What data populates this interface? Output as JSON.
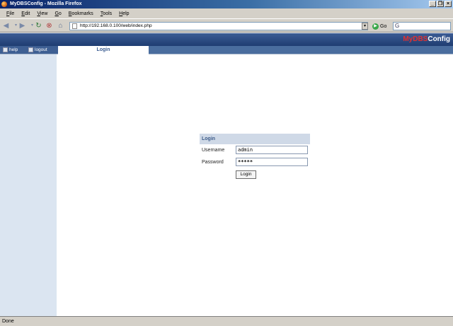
{
  "window": {
    "title": "MyDBSConfig - Mozilla Firefox",
    "controls": [
      "_",
      "❐",
      "×"
    ]
  },
  "menu": [
    "File",
    "Edit",
    "View",
    "Go",
    "Bookmarks",
    "Tools",
    "Help"
  ],
  "toolbar": {
    "url": "http://192.168.0.100/web/index.php",
    "go_label": "Go",
    "search_icon_text": "G"
  },
  "app": {
    "brand_part1": "MyDBS",
    "brand_part2": "Config",
    "nav": {
      "help": "help",
      "logout": "logout"
    },
    "active_tab": "Login"
  },
  "login": {
    "heading": "Login",
    "username_label": "Username",
    "username_value": "admin",
    "password_label": "Password",
    "password_value": "*****",
    "button": "Login"
  },
  "status": {
    "text": "Done"
  },
  "colors": {
    "header": "#2a4a82",
    "accent_red": "#e03030",
    "sidebar": "#dbe5f1"
  }
}
